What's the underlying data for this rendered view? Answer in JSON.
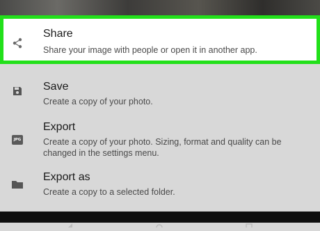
{
  "menu": {
    "items": [
      {
        "title": "Share",
        "description": "Share your image with people or open it in another app.",
        "icon": "share-icon"
      },
      {
        "title": "Save",
        "description": "Create a copy of your photo.",
        "icon": "save-icon"
      },
      {
        "title": "Export",
        "description": "Create a copy of your photo. Sizing, format and quality can be changed in the settings menu.",
        "icon": "jpg-file-icon",
        "badge": "JPG"
      },
      {
        "title": "Export as",
        "description": "Create a copy to a selected folder.",
        "icon": "folder-icon"
      }
    ]
  },
  "highlight_color": "#22e01a",
  "navbar": {
    "buttons": [
      "back-icon",
      "home-icon",
      "recents-icon"
    ]
  }
}
